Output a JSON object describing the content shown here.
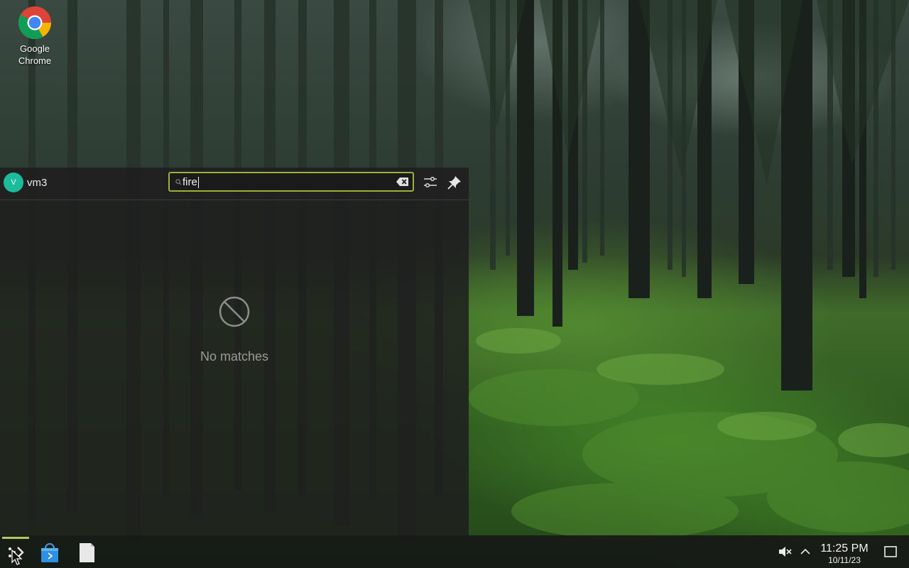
{
  "desktop": {
    "icons": [
      {
        "label": "Google\nChrome"
      }
    ]
  },
  "launcher": {
    "user": {
      "initial": "V",
      "name": "vm3"
    },
    "search": {
      "value": "fire",
      "placeholder": ""
    },
    "empty_message": "No matches",
    "accent_color": "#9ab23a"
  },
  "taskbar": {
    "clock": {
      "time": "11:25 PM",
      "date": "10/11/23"
    },
    "active_indicator_color": "#b6c55a"
  }
}
